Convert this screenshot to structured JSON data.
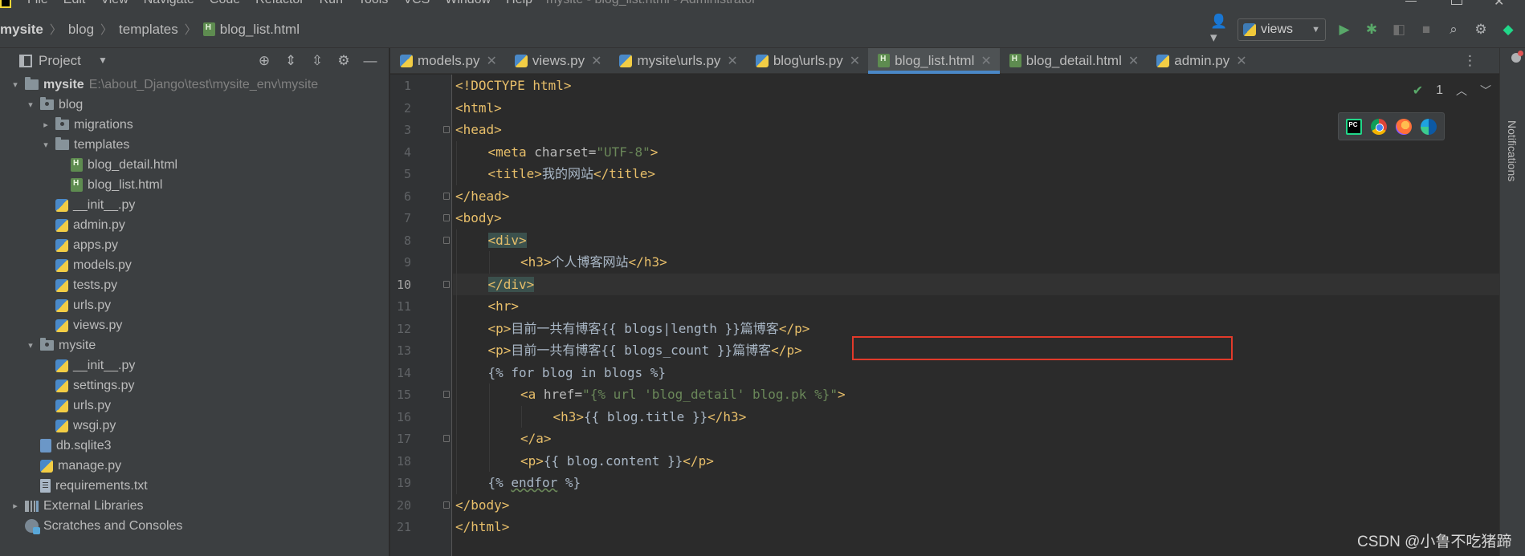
{
  "window": {
    "title": "mysite - blog_list.html - Administrator",
    "menu": [
      "File",
      "Edit",
      "View",
      "Navigate",
      "Code",
      "Refactor",
      "Run",
      "Tools",
      "VCS",
      "Window",
      "Help"
    ]
  },
  "breadcrumb": [
    "mysite",
    "blog",
    "templates",
    "blog_list.html"
  ],
  "toolbar": {
    "run_config": "views",
    "icons": [
      "user-icon",
      "python-icon",
      "run-icon",
      "debug-icon",
      "coverage-icon",
      "stop-icon",
      "search-icon",
      "settings-icon",
      "jetbrains-logo-icon"
    ]
  },
  "project_panel": {
    "title": "Project",
    "header_icons": [
      "locate-icon",
      "expand-all-icon",
      "collapse-all-icon",
      "gear-icon",
      "hide-icon"
    ],
    "tree": [
      {
        "label": "mysite",
        "path": "E:\\about_Django\\test\\mysite_env\\mysite",
        "depth": 0,
        "type": "folder",
        "expanded": true,
        "bold": true
      },
      {
        "label": "blog",
        "depth": 1,
        "type": "package",
        "expanded": true
      },
      {
        "label": "migrations",
        "depth": 2,
        "type": "package",
        "expanded": false
      },
      {
        "label": "templates",
        "depth": 2,
        "type": "folder",
        "expanded": true
      },
      {
        "label": "blog_detail.html",
        "depth": 3,
        "type": "html"
      },
      {
        "label": "blog_list.html",
        "depth": 3,
        "type": "html"
      },
      {
        "label": "__init__.py",
        "depth": 2,
        "type": "py"
      },
      {
        "label": "admin.py",
        "depth": 2,
        "type": "py"
      },
      {
        "label": "apps.py",
        "depth": 2,
        "type": "py"
      },
      {
        "label": "models.py",
        "depth": 2,
        "type": "py"
      },
      {
        "label": "tests.py",
        "depth": 2,
        "type": "py"
      },
      {
        "label": "urls.py",
        "depth": 2,
        "type": "py"
      },
      {
        "label": "views.py",
        "depth": 2,
        "type": "py"
      },
      {
        "label": "mysite",
        "depth": 1,
        "type": "package",
        "expanded": true
      },
      {
        "label": "__init__.py",
        "depth": 2,
        "type": "py"
      },
      {
        "label": "settings.py",
        "depth": 2,
        "type": "py"
      },
      {
        "label": "urls.py",
        "depth": 2,
        "type": "py"
      },
      {
        "label": "wsgi.py",
        "depth": 2,
        "type": "py"
      },
      {
        "label": "db.sqlite3",
        "depth": 1,
        "type": "db"
      },
      {
        "label": "manage.py",
        "depth": 1,
        "type": "py"
      },
      {
        "label": "requirements.txt",
        "depth": 1,
        "type": "txt"
      },
      {
        "label": "External Libraries",
        "depth": 0,
        "type": "lib",
        "expanded": false
      },
      {
        "label": "Scratches and Consoles",
        "depth": 0,
        "type": "scratch"
      }
    ]
  },
  "tabs": [
    {
      "label": "models.py",
      "type": "py",
      "active": false
    },
    {
      "label": "views.py",
      "type": "py",
      "active": false
    },
    {
      "label": "mysite\\urls.py",
      "type": "py",
      "active": false
    },
    {
      "label": "blog\\urls.py",
      "type": "py",
      "active": false
    },
    {
      "label": "blog_list.html",
      "type": "html",
      "active": true
    },
    {
      "label": "blog_detail.html",
      "type": "html",
      "active": false
    },
    {
      "label": "admin.py",
      "type": "py",
      "active": false
    }
  ],
  "editor": {
    "current_line": 10,
    "inspection_count": "1",
    "lines": [
      {
        "n": "1",
        "indent": 0,
        "tokens": [
          [
            "tag",
            "<!DOCTYPE html>"
          ]
        ]
      },
      {
        "n": "2",
        "indent": 0,
        "tokens": [
          [
            "tag",
            "<html>"
          ]
        ]
      },
      {
        "n": "3",
        "indent": 0,
        "tokens": [
          [
            "tag",
            "<head>"
          ]
        ]
      },
      {
        "n": "4",
        "indent": 1,
        "tokens": [
          [
            "tag",
            "<meta "
          ],
          [
            "attr",
            "charset="
          ],
          [
            "str",
            "\"UTF-8\""
          ],
          [
            "tag",
            ">"
          ]
        ]
      },
      {
        "n": "5",
        "indent": 1,
        "tokens": [
          [
            "tag",
            "<title>"
          ],
          [
            "text",
            "我的网站"
          ],
          [
            "tag",
            "</title>"
          ]
        ]
      },
      {
        "n": "6",
        "indent": 0,
        "tokens": [
          [
            "tag",
            "</head>"
          ]
        ]
      },
      {
        "n": "7",
        "indent": 0,
        "tokens": [
          [
            "tag",
            "<body>"
          ]
        ]
      },
      {
        "n": "8",
        "indent": 1,
        "tokens": [
          [
            "taghl",
            "<div>"
          ]
        ]
      },
      {
        "n": "9",
        "indent": 2,
        "tokens": [
          [
            "tag",
            "<h3>"
          ],
          [
            "text",
            "个人博客网站"
          ],
          [
            "tag",
            "</h3>"
          ]
        ]
      },
      {
        "n": "10",
        "indent": 1,
        "tokens": [
          [
            "taghl",
            "</div>"
          ]
        ]
      },
      {
        "n": "11",
        "indent": 1,
        "tokens": [
          [
            "tag",
            "<hr>"
          ]
        ]
      },
      {
        "n": "12",
        "indent": 1,
        "tokens": [
          [
            "tag",
            "<p>"
          ],
          [
            "text",
            "目前一共有博客{{ blogs|length }}篇博客"
          ],
          [
            "tag",
            "</p>"
          ]
        ]
      },
      {
        "n": "13",
        "indent": 1,
        "tokens": [
          [
            "tag",
            "<p>"
          ],
          [
            "text",
            "目前一共有博客{{ blogs_count }}篇博客"
          ],
          [
            "tag",
            "</p>"
          ]
        ]
      },
      {
        "n": "14",
        "indent": 1,
        "tokens": [
          [
            "text",
            "{% for blog in blogs %}"
          ]
        ]
      },
      {
        "n": "15",
        "indent": 2,
        "tokens": [
          [
            "tag",
            "<a "
          ],
          [
            "attr",
            "href="
          ],
          [
            "str",
            "\"{% url 'blog_detail' blog.pk %}\""
          ],
          [
            "tag",
            ">"
          ]
        ]
      },
      {
        "n": "16",
        "indent": 3,
        "tokens": [
          [
            "tag",
            "<h3>"
          ],
          [
            "text",
            "{{ blog.title }}"
          ],
          [
            "tag",
            "</h3>"
          ]
        ]
      },
      {
        "n": "17",
        "indent": 2,
        "tokens": [
          [
            "tag",
            "</a>"
          ]
        ]
      },
      {
        "n": "18",
        "indent": 2,
        "tokens": [
          [
            "tag",
            "<p>"
          ],
          [
            "text",
            "{{ blog.content }}"
          ],
          [
            "tag",
            "</p>"
          ]
        ]
      },
      {
        "n": "19",
        "indent": 1,
        "tokens": [
          [
            "text",
            "{% "
          ],
          [
            "ul",
            "endfor"
          ],
          [
            "text",
            " %}"
          ]
        ]
      },
      {
        "n": "20",
        "indent": 0,
        "tokens": [
          [
            "tag",
            "</body>"
          ]
        ]
      },
      {
        "n": "21",
        "indent": 0,
        "tokens": [
          [
            "tag",
            "</html>"
          ]
        ]
      }
    ]
  },
  "browser_icons": [
    "pycharm-icon",
    "chrome-icon",
    "firefox-icon",
    "edge-icon"
  ],
  "right_strip": {
    "label": "Notifications"
  },
  "watermark": "CSDN @小鲁不吃猪蹄"
}
